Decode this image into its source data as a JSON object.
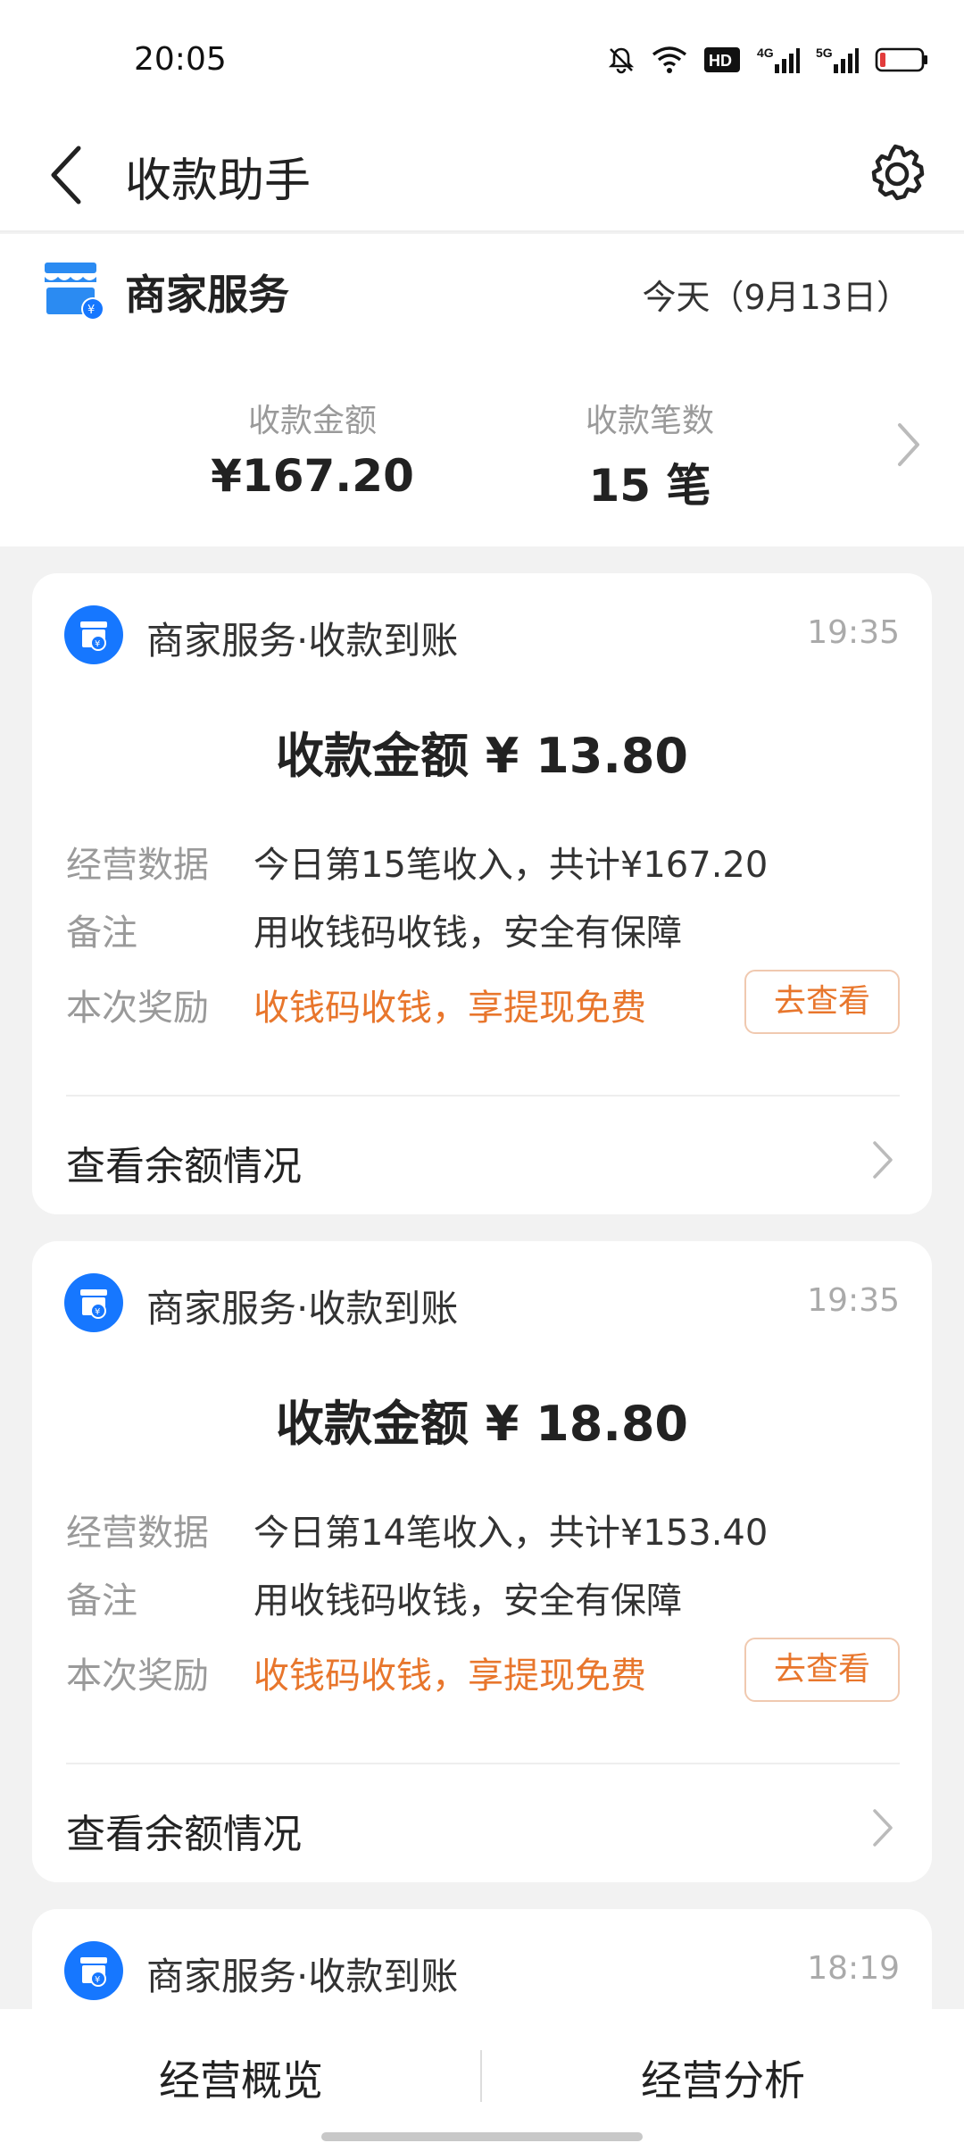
{
  "status_bar": {
    "time": "20:05",
    "icons": [
      "mute-icon",
      "wifi-icon",
      "hd-icon",
      "4g-signal-icon",
      "5g-signal-icon",
      "battery-icon"
    ],
    "hd_text": "HD",
    "net_4g": "4G",
    "net_5g": "5G"
  },
  "header": {
    "title": "收款助手"
  },
  "summary": {
    "merchant_name": "商家服务",
    "date_label": "今天（9月13日）",
    "amount_label": "收款金额",
    "amount_value": "¥167.20",
    "count_label": "收款笔数",
    "count_value": "15 笔"
  },
  "cards": [
    {
      "title": "商家服务·收款到账",
      "time": "19:35",
      "amount": "收款金额 ¥ 13.80",
      "business_label": "经营数据",
      "business_value": "今日第15笔收入，共计¥167.20",
      "note_label": "备注",
      "note_value": "用收钱码收钱，安全有保障",
      "reward_label": "本次奖励",
      "reward_value": "收钱码收钱，享提现免费",
      "check_button": "去查看",
      "balance_link": "查看余额情况"
    },
    {
      "title": "商家服务·收款到账",
      "time": "19:35",
      "amount": "收款金额 ¥ 18.80",
      "business_label": "经营数据",
      "business_value": "今日第14笔收入，共计¥153.40",
      "note_label": "备注",
      "note_value": "用收钱码收钱，安全有保障",
      "reward_label": "本次奖励",
      "reward_value": "收钱码收钱，享提现免费",
      "check_button": "去查看",
      "balance_link": "查看余额情况"
    },
    {
      "title": "商家服务·收款到账",
      "time": "18:19"
    }
  ],
  "bottom_nav": {
    "overview": "经营概览",
    "analysis": "经营分析"
  },
  "colors": {
    "accent_blue": "#1677ff",
    "reward_orange": "#e8762c",
    "muted_gray": "#9a9a9a"
  }
}
